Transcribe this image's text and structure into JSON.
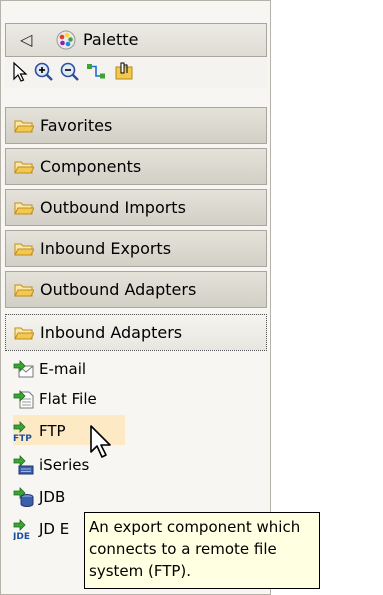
{
  "palette": {
    "title": "Palette",
    "collapse_glyph": "◁"
  },
  "tools": [
    "select-arrow-icon",
    "zoom-in-icon",
    "zoom-out-icon",
    "connection-icon",
    "marquee-icon"
  ],
  "drawers": [
    {
      "label": "Favorites",
      "open": false
    },
    {
      "label": "Components",
      "open": false
    },
    {
      "label": "Outbound Imports",
      "open": false
    },
    {
      "label": "Inbound Exports",
      "open": false
    },
    {
      "label": "Outbound Adapters",
      "open": false
    },
    {
      "label": "Inbound Adapters",
      "open": true
    }
  ],
  "entries": [
    {
      "label": "E-mail",
      "icon": "email-export-icon",
      "selected": false
    },
    {
      "label": "Flat File",
      "icon": "flat-file-export-icon",
      "selected": false
    },
    {
      "label": "FTP",
      "icon": "ftp-export-icon",
      "selected": true
    },
    {
      "label": "iSeries",
      "icon": "iseries-export-icon",
      "selected": false
    },
    {
      "label": "JDB",
      "icon": "jdbc-export-icon",
      "selected": false
    },
    {
      "label": "JD E",
      "icon": "jde-export-icon",
      "selected": false
    }
  ],
  "tooltip": {
    "line1": "An export component which",
    "line2": "connects to a remote file",
    "line3": "system (FTP)."
  },
  "colors": {
    "selected_bg": "#fde9c4",
    "tooltip_bg": "#ffffe1",
    "folder_yellow": "#f3c84e",
    "arrow_green": "#3aa534"
  }
}
